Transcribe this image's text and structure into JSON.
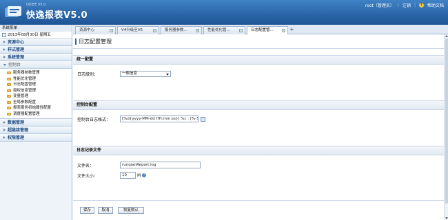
{
  "header": {
    "logo_small": "QUIEE V5.0",
    "logo_title": "快逸报表V5.0",
    "user": "root（管理员）",
    "logout": "注销",
    "help": "帮助文档"
  },
  "sidebar": {
    "title": "系统菜单",
    "date": "2013年08月30日 星期五",
    "sections": [
      {
        "label": "资源中心"
      },
      {
        "label": "样式管理"
      },
      {
        "label": "系统管理"
      }
    ],
    "control": {
      "label": "控制台",
      "items": [
        {
          "label": "服务器参数管理"
        },
        {
          "label": "性能优化管理"
        },
        {
          "label": "日志配置管理"
        },
        {
          "label": "授权信息管理"
        },
        {
          "label": "变量管理"
        },
        {
          "label": "全局参数配置"
        },
        {
          "label": "报表服务初始属性配置"
        },
        {
          "label": "调度器配置管理"
        }
      ]
    },
    "bottom_sections": [
      {
        "label": "数据管理"
      },
      {
        "label": "超链接管理"
      },
      {
        "label": "权限管理"
      }
    ]
  },
  "tabs": [
    {
      "label": "资源中心"
    },
    {
      "label": "V4升级至V5"
    },
    {
      "label": "服务器参数..."
    },
    {
      "label": "性能优化管..."
    },
    {
      "label": "日志配置管..."
    }
  ],
  "main": {
    "title": "日志配置管理",
    "unified": {
      "heading": "统一配置",
      "level_label": "日志级别：",
      "level_value": "一般信息"
    },
    "console": {
      "heading": "控制台配置",
      "format_label": "控制台日志格式：",
      "format_value": "[%d{yyyy-MM-dd HH:mm:ss}] %c : [%-5p"
    },
    "file": {
      "heading": "日志记录文件",
      "name_label": "文件名：",
      "name_value": "runqianReport.log",
      "size_label": "文件大小：",
      "size_value": "10",
      "size_unit": "M"
    },
    "buttons": {
      "save": "保存",
      "cancel": "取消",
      "reset": "恢复默认"
    }
  },
  "colors": {
    "header": "#2a64a6",
    "sidebar_bg": "#eef3f9",
    "panel_head": "#e2e9f2"
  }
}
